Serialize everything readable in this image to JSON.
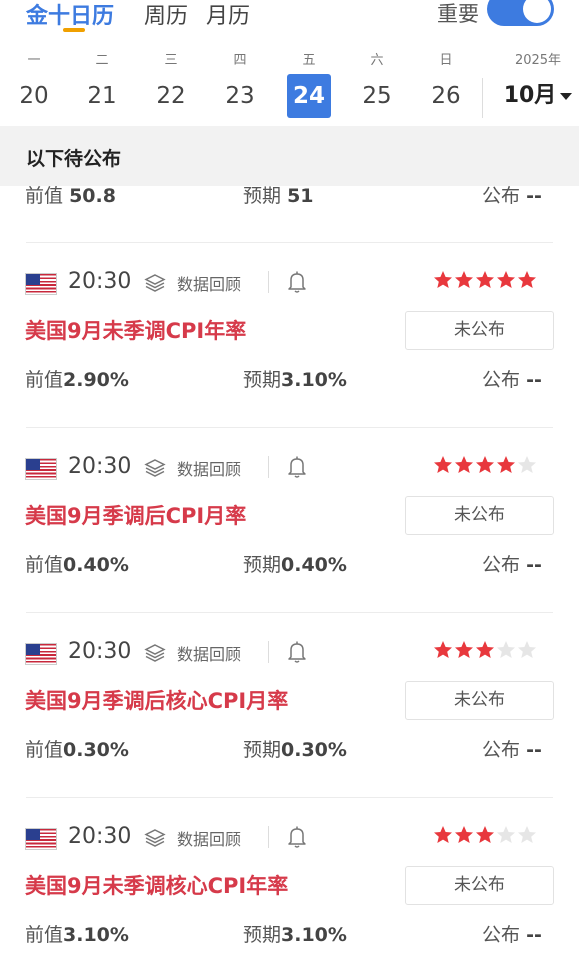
{
  "tabs": [
    {
      "label": "金十日历",
      "active": true
    },
    {
      "label": "周历",
      "active": false
    },
    {
      "label": "月历",
      "active": false
    }
  ],
  "important": {
    "label": "重要",
    "enabled": true
  },
  "week": {
    "days": [
      {
        "name": "一",
        "num": "20",
        "active": false
      },
      {
        "name": "二",
        "num": "21",
        "active": false
      },
      {
        "name": "三",
        "num": "22",
        "active": false
      },
      {
        "name": "四",
        "num": "23",
        "active": false
      },
      {
        "name": "五",
        "num": "24",
        "active": true
      },
      {
        "name": "六",
        "num": "25",
        "active": false
      },
      {
        "name": "日",
        "num": "26",
        "active": false
      }
    ],
    "year": "2025年",
    "month": "10月"
  },
  "section_title": "以下待公布",
  "partial_row": {
    "prev_label": "前值",
    "prev_value": "50.8",
    "forecast_label": "预期",
    "forecast_value": "51",
    "publish_label": "公布",
    "publish_value": "--"
  },
  "events": [
    {
      "time": "20:30",
      "review": "数据回顾",
      "stars": 5,
      "icon": "us-flag-icon",
      "title": "美国9月未季调CPI年率",
      "status": "未公布",
      "prev_label": "前值",
      "prev_value": "2.90%",
      "forecast_label": "预期",
      "forecast_value": "3.10%",
      "publish_label": "公布",
      "publish_value": "--"
    },
    {
      "time": "20:30",
      "review": "数据回顾",
      "stars": 4,
      "icon": "us-flag-icon",
      "title": "美国9月季调后CPI月率",
      "status": "未公布",
      "prev_label": "前值",
      "prev_value": "0.40%",
      "forecast_label": "预期",
      "forecast_value": "0.40%",
      "publish_label": "公布",
      "publish_value": "--"
    },
    {
      "time": "20:30",
      "review": "数据回顾",
      "stars": 3,
      "icon": "us-flag-icon",
      "title": "美国9月季调后核心CPI月率",
      "status": "未公布",
      "prev_label": "前值",
      "prev_value": "0.30%",
      "forecast_label": "预期",
      "forecast_value": "0.30%",
      "publish_label": "公布",
      "publish_value": "--"
    },
    {
      "time": "20:30",
      "review": "数据回顾",
      "stars": 3,
      "icon": "us-flag-icon",
      "title": "美国9月未季调核心CPI年率",
      "status": "未公布",
      "prev_label": "前值",
      "prev_value": "3.10%",
      "forecast_label": "预期",
      "forecast_value": "3.10%",
      "publish_label": "公布",
      "publish_value": "--"
    }
  ],
  "colors": {
    "accent": "#3d7be0",
    "title_red": "#d63a4a",
    "star_on": "#e8383d",
    "star_off": "#e6e6e6",
    "tab_underline": "#f0a000"
  }
}
